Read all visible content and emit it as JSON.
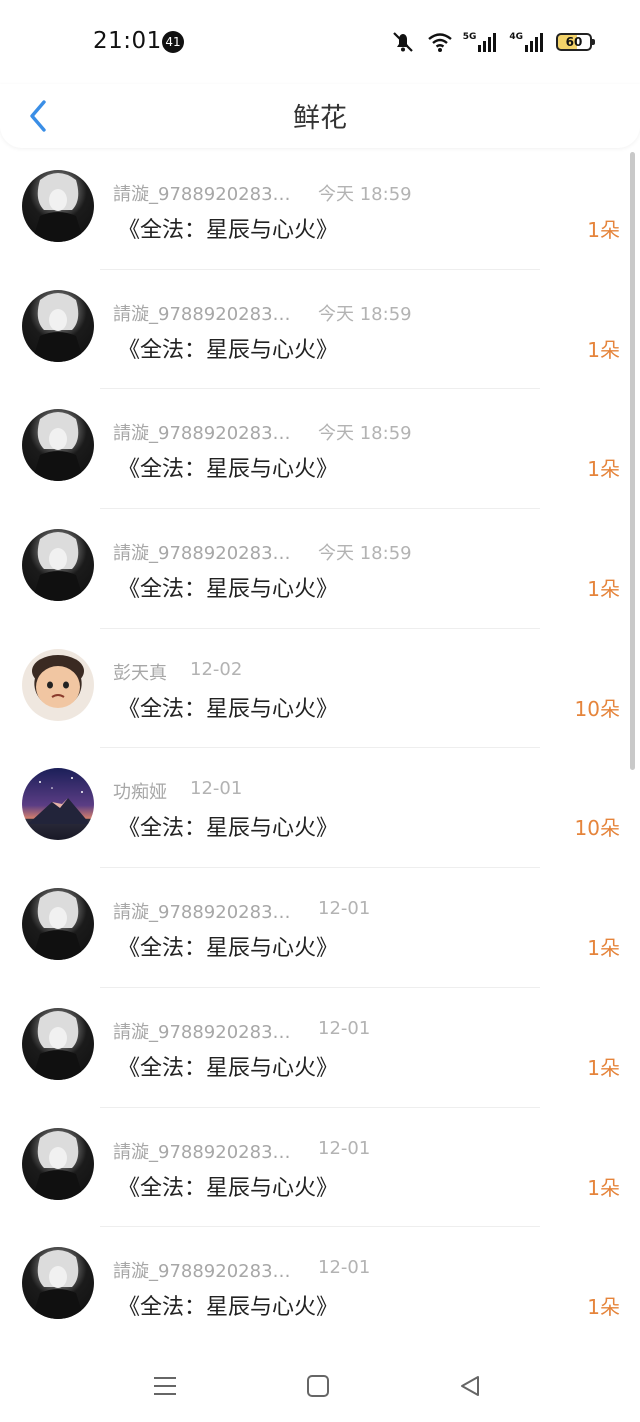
{
  "status_bar": {
    "time": "21:01",
    "notification_count": "41",
    "net_5g": "5G",
    "net_4g": "4G",
    "battery": "60",
    "icons": [
      "bell-muted-icon",
      "wifi-icon",
      "signal-5g-icon",
      "signal-4g-icon",
      "battery-icon"
    ]
  },
  "header": {
    "title": "鲜花",
    "back_icon": "chevron-left-icon"
  },
  "colors": {
    "accent_back": "#3a8ee6",
    "flower_count": "#e5843b",
    "meta_text": "#a7a7a7"
  },
  "items": [
    {
      "name": "請漩_9788920283…",
      "time": "今天 18:59",
      "book": "《全法：星辰与心火》",
      "count": "1朵",
      "avatar": "gothic"
    },
    {
      "name": "請漩_9788920283…",
      "time": "今天 18:59",
      "book": "《全法：星辰与心火》",
      "count": "1朵",
      "avatar": "gothic"
    },
    {
      "name": "請漩_9788920283…",
      "time": "今天 18:59",
      "book": "《全法：星辰与心火》",
      "count": "1朵",
      "avatar": "gothic"
    },
    {
      "name": "請漩_9788920283…",
      "time": "今天 18:59",
      "book": "《全法：星辰与心火》",
      "count": "1朵",
      "avatar": "gothic"
    },
    {
      "name": "彭天真",
      "time": "12-02",
      "book": "《全法：星辰与心火》",
      "count": "10朵",
      "avatar": "child"
    },
    {
      "name": "功痴娅",
      "time": "12-01",
      "book": "《全法：星辰与心火》",
      "count": "10朵",
      "avatar": "mountain"
    },
    {
      "name": "請漩_9788920283…",
      "time": "12-01",
      "book": "《全法：星辰与心火》",
      "count": "1朵",
      "avatar": "gothic"
    },
    {
      "name": "請漩_9788920283…",
      "time": "12-01",
      "book": "《全法：星辰与心火》",
      "count": "1朵",
      "avatar": "gothic"
    },
    {
      "name": "請漩_9788920283…",
      "time": "12-01",
      "book": "《全法：星辰与心火》",
      "count": "1朵",
      "avatar": "gothic"
    },
    {
      "name": "請漩_9788920283…",
      "time": "12-01",
      "book": "《全法：星辰与心火》",
      "count": "1朵",
      "avatar": "gothic"
    }
  ],
  "nav": {
    "icons": [
      "menu-icon",
      "home-square-icon",
      "back-triangle-icon"
    ]
  }
}
